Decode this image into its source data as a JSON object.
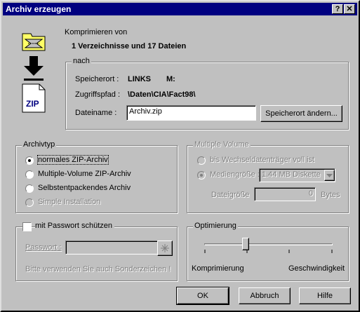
{
  "window": {
    "title": "Archiv erzeugen",
    "help_btn": "?",
    "close_btn": "✕"
  },
  "compress": {
    "label": "Komprimieren von",
    "summary": "1 Verzeichnisse und 17 Dateien"
  },
  "nach": {
    "group_label": "nach",
    "speicherort_label": "Speicherort :",
    "speicherort_value": "LINKS",
    "drive_value": "M:",
    "zugriffspfad_label": "Zugriffspfad :",
    "zugriffspfad_value": "\\Daten\\CIA\\Fact98\\",
    "dateiname_label": "Dateiname :",
    "dateiname_value": "Archiv.zip",
    "change_button": "Speicherort ändern..."
  },
  "archivtyp": {
    "group_label": "Archivtyp",
    "options": [
      "normales ZIP-Archiv",
      "Multiple-Volume ZIP-Archiv",
      "Selbstentpackendes Archiv",
      "Simple Installation"
    ],
    "selected_index": 0
  },
  "multiple_volume": {
    "group_label": "Multiple Volume",
    "option1": "bis Wechseldatenträger voll ist",
    "option2": "Mediengröße :",
    "media_select": "1.44 MB Diskette",
    "dateigroesse_label": "Dateigröße",
    "dateigroesse_value": "0",
    "bytes_label": "Bytes"
  },
  "password": {
    "checkbox_label": "mit Passwort schützen",
    "field_label": "Passwort :",
    "hint": "Bitte verwenden Sie auch Sonderzeichen !"
  },
  "optimierung": {
    "group_label": "Optimierung",
    "left_label": "Komprimierung",
    "right_label": "Geschwindigkeit",
    "slider_value": 0.33
  },
  "buttons": {
    "ok": "OK",
    "cancel": "Abbruch",
    "help": "Hilfe"
  },
  "icons": {
    "zip_label": "ZIP"
  }
}
